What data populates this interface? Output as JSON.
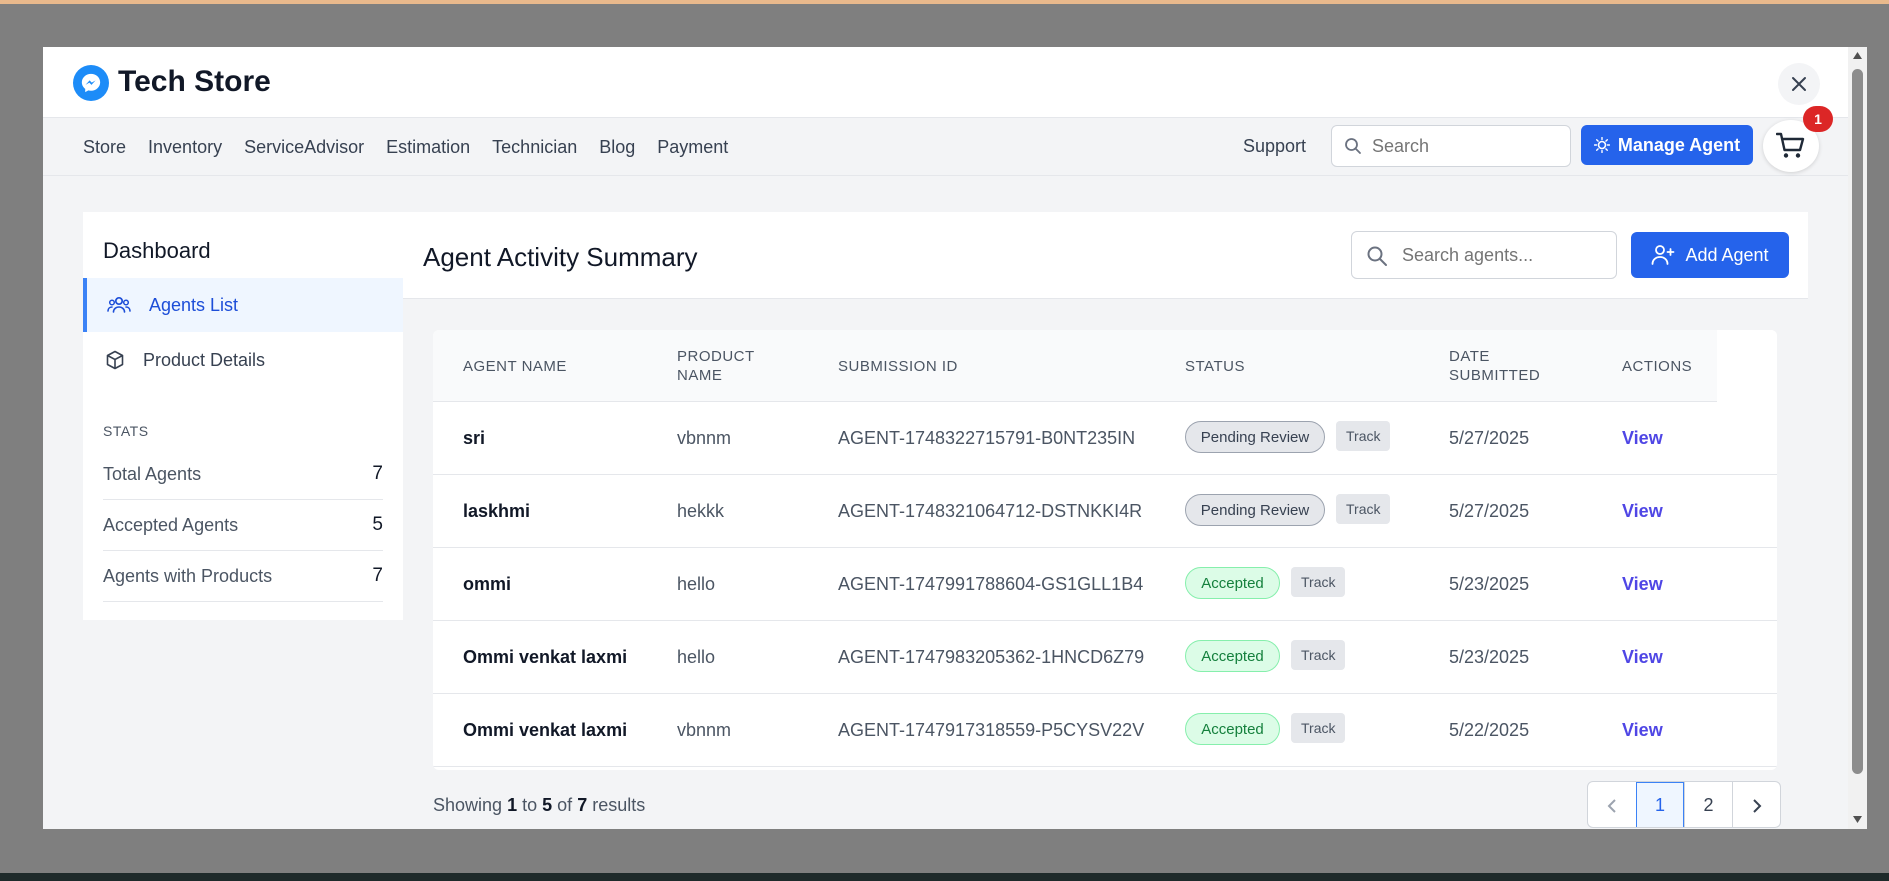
{
  "app": {
    "title": "Tech Store"
  },
  "nav": {
    "links": [
      "Store",
      "Inventory",
      "ServiceAdvisor",
      "Estimation",
      "Technician",
      "Blog",
      "Payment"
    ],
    "support": "Support",
    "search_placeholder": "Search",
    "manage_agent_label": "Manage Agent",
    "cart_count": "1"
  },
  "sidebar": {
    "title": "Dashboard",
    "items": [
      {
        "label": "Agents List",
        "icon": "users-icon",
        "active": true
      },
      {
        "label": "Product Details",
        "icon": "box-icon",
        "active": false
      }
    ],
    "stats_label": "STATS",
    "stats": [
      {
        "label": "Total Agents",
        "value": "7"
      },
      {
        "label": "Accepted Agents",
        "value": "5"
      },
      {
        "label": "Agents with Products",
        "value": "7"
      }
    ]
  },
  "main": {
    "title": "Agent Activity Summary",
    "search_placeholder": "Search agents...",
    "add_agent_label": "Add Agent"
  },
  "table": {
    "headers": {
      "agent_name": "AGENT NAME",
      "product_line1": "PRODUCT",
      "product_line2": "NAME",
      "submission_id": "SUBMISSION ID",
      "status": "STATUS",
      "date_line1": "DATE",
      "date_line2": "SUBMITTED",
      "actions": "ACTIONS"
    },
    "rows": [
      {
        "agent": "sri",
        "product": "vbnnm",
        "submission": "AGENT-1748322715791-B0NT235IN",
        "status": "Pending Review",
        "status_type": "pending",
        "track": "Track",
        "date": "5/27/2025",
        "action": "View"
      },
      {
        "agent": "laskhmi",
        "product": "hekkk",
        "submission": "AGENT-1748321064712-DSTNKKI4R",
        "status": "Pending Review",
        "status_type": "pending",
        "track": "Track",
        "date": "5/27/2025",
        "action": "View"
      },
      {
        "agent": "ommi",
        "product": "hello",
        "submission": "AGENT-1747991788604-GS1GLL1B4",
        "status": "Accepted",
        "status_type": "accepted",
        "track": "Track",
        "date": "5/23/2025",
        "action": "View"
      },
      {
        "agent": "Ommi venkat laxmi",
        "product": "hello",
        "submission": "AGENT-1747983205362-1HNCD6Z79",
        "status": "Accepted",
        "status_type": "accepted",
        "track": "Track",
        "date": "5/23/2025",
        "action": "View"
      },
      {
        "agent": "Ommi venkat laxmi",
        "product": "vbnnm",
        "submission": "AGENT-1747917318559-P5CYSV22V",
        "status": "Accepted",
        "status_type": "accepted",
        "track": "Track",
        "date": "5/22/2025",
        "action": "View"
      }
    ]
  },
  "footer": {
    "showing": "Showing",
    "from": "1",
    "to_word": "to",
    "to": "5",
    "of_word": "of",
    "total": "7",
    "results": "results"
  },
  "pagination": {
    "prev": "‹",
    "pages": [
      "1",
      "2"
    ],
    "current": "1",
    "next": "›"
  },
  "colors": {
    "primary": "#2563eb",
    "accent_link": "#4f46e5",
    "accepted": "#15803d",
    "badge": "#dc2626"
  }
}
